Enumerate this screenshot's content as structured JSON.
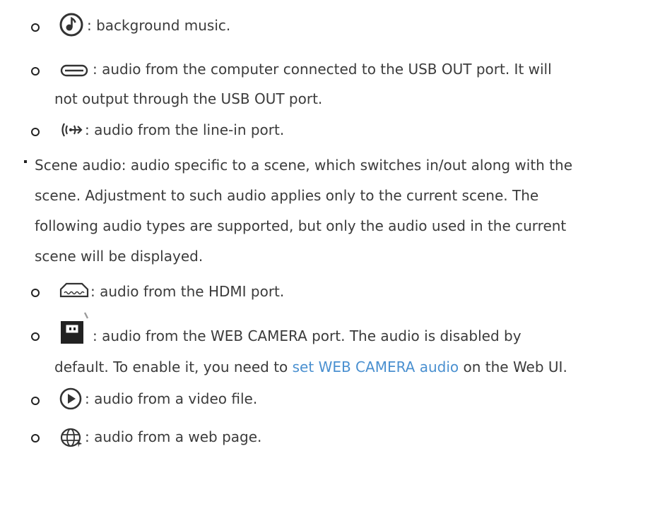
{
  "items": {
    "bg_music": {
      "icon": "music-note-icon",
      "text": ": background music."
    },
    "usb_out": {
      "icon": "usb-cable-icon",
      "line1": ": audio from the computer connected to the USB OUT port. It will",
      "line2": "not output through the USB OUT port."
    },
    "line_in": {
      "icon": "line-in-icon",
      "text": ": audio from the line-in port."
    },
    "scene_audio": {
      "line1": "Scene audio: audio specific to a scene, which switches in/out along with the",
      "line2": "scene. Adjustment to such audio applies only to the current scene. The",
      "line3": "following audio types are supported, but only the audio used in the current",
      "line4": "scene will be displayed."
    },
    "hdmi": {
      "icon": "hdmi-port-icon",
      "text": ": audio from the HDMI port."
    },
    "web_camera": {
      "icon": "web-camera-icon",
      "line1": ": audio from the WEB CAMERA port. The audio is disabled by",
      "line2_before": "default. To enable it, you need to ",
      "link": "set WEB CAMERA audio",
      "line2_after": " on the Web UI."
    },
    "video_file": {
      "icon": "play-icon",
      "text": ": audio from a video file."
    },
    "web_page": {
      "icon": "globe-icon",
      "text": ": audio from a web page."
    }
  },
  "colors": {
    "text": "#3b3b3b",
    "link": "#4a90d0"
  }
}
